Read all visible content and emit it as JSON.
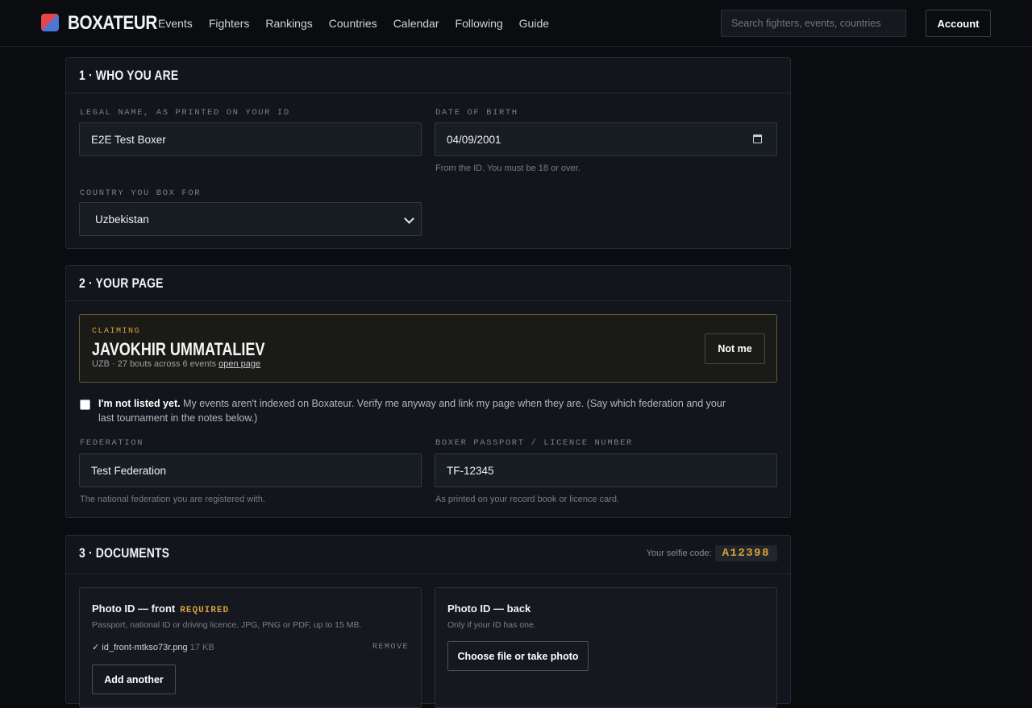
{
  "app": {
    "brand": "BOXATEUR",
    "nav": [
      "Events",
      "Fighters",
      "Rankings",
      "Countries",
      "Calendar",
      "Following",
      "Guide"
    ],
    "search_placeholder": "Search fighters, events, countries",
    "account_label": "Account"
  },
  "section1": {
    "title": "1 · WHO YOU ARE",
    "legal_name_label": "LEGAL NAME, AS PRINTED ON YOUR ID",
    "legal_name_value": "E2E Test Boxer",
    "dob_label": "DATE OF BIRTH",
    "dob_value": "04/09/2001",
    "dob_hint": "From the ID. You must be 18 or over.",
    "country_label": "COUNTRY YOU BOX FOR",
    "country_value": "Uzbekistan"
  },
  "section2": {
    "title": "2 · YOUR PAGE",
    "claim_label": "CLAIMING",
    "claim_name": "JAVOKHIR UMMATALIEV",
    "claim_meta": "UZB · 27 bouts across 6 events",
    "claim_link": "open page",
    "not_me_label": "Not me",
    "not_listed_strong": "I'm not listed yet.",
    "not_listed_text": " My events aren't indexed on Boxateur. Verify me anyway and link my page when they are. (Say which federation and your last tournament in the notes below.)",
    "not_listed_checked": false,
    "federation_label": "FEDERATION",
    "federation_value": "Test Federation",
    "federation_hint": "The national federation you are registered with.",
    "licence_label": "BOXER PASSPORT / LICENCE NUMBER",
    "licence_value": "TF-12345",
    "licence_hint": "As printed on your record book or licence card."
  },
  "section3": {
    "title": "3 · DOCUMENTS",
    "selfie_label": "Your selfie code:",
    "selfie_code": "A12398",
    "front": {
      "title": "Photo ID — front",
      "required": "REQUIRED",
      "subtitle": "Passport, national ID or driving licence. JPG, PNG or PDF, up to 15 MB.",
      "file_check": "✓",
      "file_name": "id_front-mtkso73r.png",
      "file_size": "17 KB",
      "remove_label": "REMOVE",
      "add_label": "Add another"
    },
    "back": {
      "title": "Photo ID — back",
      "subtitle": "Only if your ID has one.",
      "choose_label": "Choose file or take photo"
    }
  },
  "colors": {
    "accent": "#d9a23e",
    "bg": "#0a0c10",
    "card": "#12151b"
  }
}
